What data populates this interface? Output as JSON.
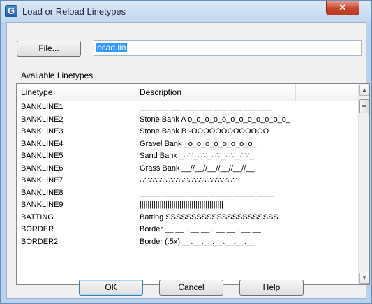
{
  "window": {
    "title": "Load or Reload Linetypes",
    "icon_letter": "G",
    "close_glyph": "✕"
  },
  "file": {
    "button_label": "File...",
    "value": "bcad.lin"
  },
  "available_label": "Available Linetypes",
  "list": {
    "columns": [
      "Linetype",
      "Description",
      ""
    ],
    "rows": [
      {
        "name": "BANKLINE1",
        "desc": "___ ___ ___ ___ ___ ___ ___ ___ ___"
      },
      {
        "name": "BANKLINE2",
        "desc": "Stone Bank A o_o_o_o_o_o_o_o_o_o_o_o_"
      },
      {
        "name": "BANKLINE3",
        "desc": "Stone Bank B -OOOOOOOOOOOOO"
      },
      {
        "name": "BANKLINE4",
        "desc": "Gravel Bank _o_o_o_o_o_o_o_o_"
      },
      {
        "name": "BANKLINE5",
        "desc": "Sand Bank _∴∵_∴∵_∴∵_∴∵_∴∵_"
      },
      {
        "name": "BANKLINE6",
        "desc": "Grass Bank __//__//__//__//__//__"
      },
      {
        "name": "BANKLINE7",
        "desc": "∴∵∴∵∴∵∴∵∴∵∴∵∴∵∴∵∴∵∴∵"
      },
      {
        "name": "BANKLINE8",
        "desc": "_____ _____ _____ _____ _____ ____"
      },
      {
        "name": "BANKLINE9",
        "desc": "||||||||||||||||||||||||||||||||||||||||||"
      },
      {
        "name": "BATTING",
        "desc": "Batting SSSSSSSSSSSSSSSSSSSSSS"
      },
      {
        "name": "BORDER",
        "desc": "Border __ __ . __ __ . __ __ . __ __"
      },
      {
        "name": "BORDER2",
        "desc": "Border (.5x) __.__.__.__.__.__.__"
      }
    ]
  },
  "scrollbar": {
    "up_glyph": "▲",
    "down_glyph": "▼"
  },
  "buttons": {
    "ok": "OK",
    "cancel": "Cancel",
    "help": "Help"
  },
  "colors": {
    "selection": "#3399ff",
    "close": "#c9442c"
  }
}
